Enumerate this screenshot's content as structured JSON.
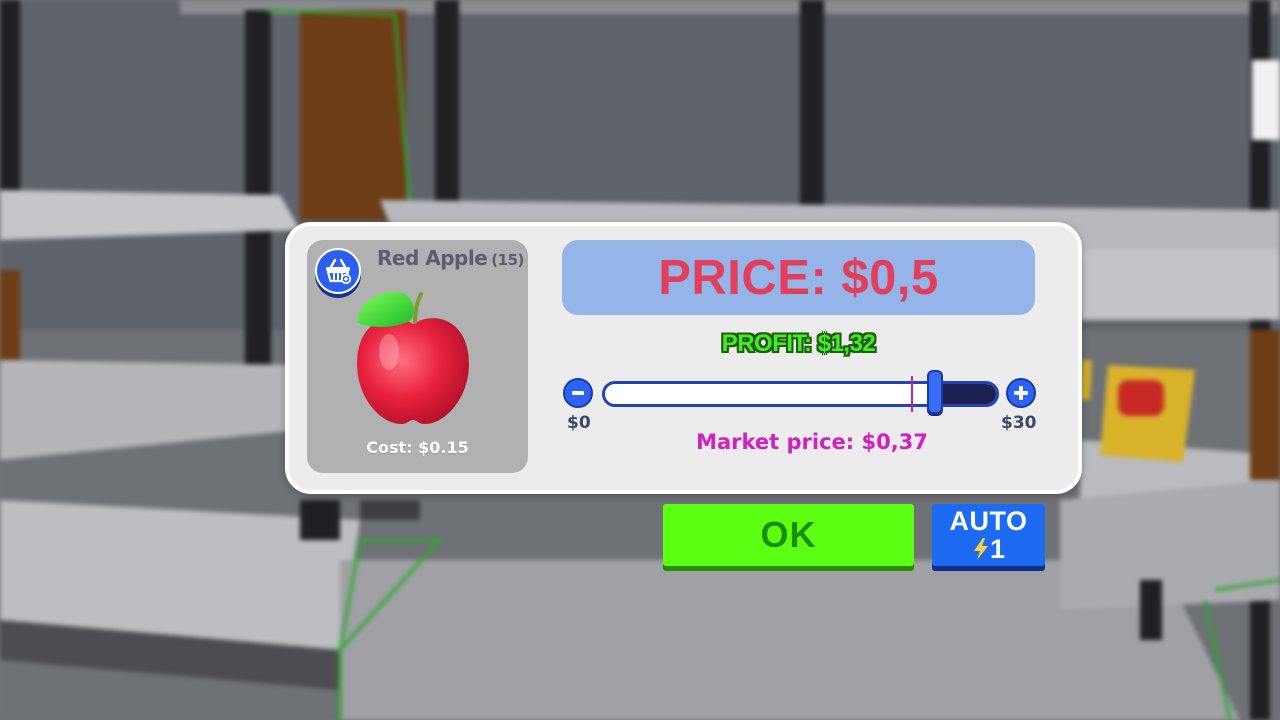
{
  "item": {
    "name": "Red Apple",
    "quantity": "(15)",
    "cost_text": "Cost: $0.15"
  },
  "pricing": {
    "price_text": "PRICE: $0,5",
    "profit_text": "PROFIT: $1,32",
    "min_label": "$0",
    "max_label": "$30",
    "market_price_text": "Market price: $0,37",
    "slider_level": 0.84,
    "market_marker_level": 0.78
  },
  "actions": {
    "ok_label": "OK",
    "auto_label": "AUTO",
    "auto_count": "1"
  },
  "icons": {
    "basket": "shopping-basket-icon",
    "apple": "red-apple-image",
    "minus": "minus-icon",
    "plus": "plus-icon",
    "bolt": "lightning-bolt-icon"
  },
  "colors": {
    "price_text": "#e23f5c",
    "price_panel": "#95b4e8",
    "profit_text": "#46ea2b",
    "market_price_text": "#d21fbf",
    "ok_button": "#5cff11",
    "auto_button": "#1d6bf3",
    "slider_accent": "#2d63f2"
  }
}
